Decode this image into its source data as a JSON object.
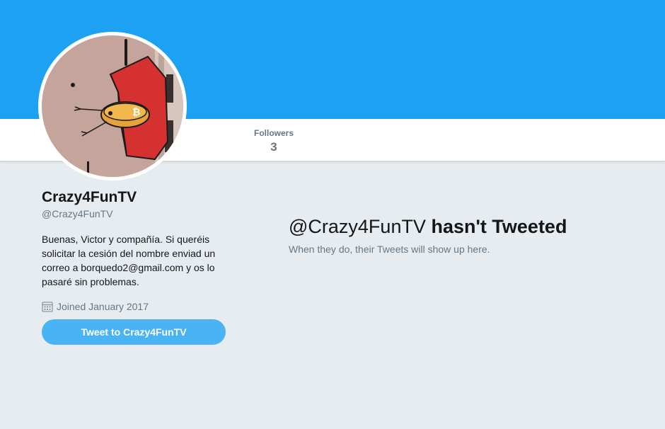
{
  "banner": {
    "color": "#1da1f2"
  },
  "nav": {
    "followers_label": "Followers",
    "followers_count": "3"
  },
  "profile": {
    "name": "Crazy4FunTV",
    "handle": "@Crazy4FunTV",
    "bio": "Buenas, Victor y compañía. Si queréis solicitar la cesión del nombre enviad un correo a borquedo2@gmail.com y os lo pasaré sin problemas.",
    "joined": "Joined January 2017",
    "joined_icon": "calendar-icon",
    "tweet_button": "Tweet to Crazy4FunTV"
  },
  "timeline": {
    "empty_handle": "@Crazy4FunTV",
    "empty_title": "hasn't Tweeted",
    "empty_subtitle": "When they do, their Tweets will show up here."
  },
  "colors": {
    "accent": "#1da1f2",
    "button": "#4ab3f4",
    "background": "#e6ecf0",
    "muted_text": "#657786"
  }
}
